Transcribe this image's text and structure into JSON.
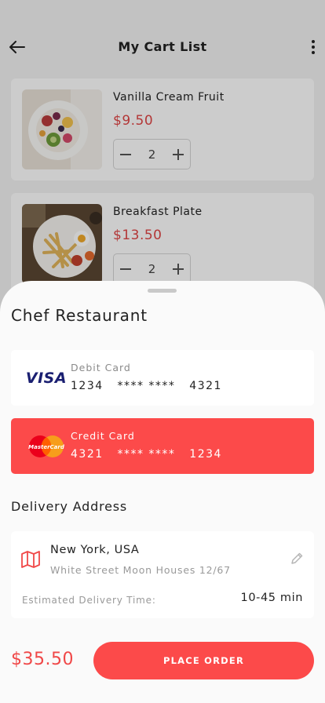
{
  "header": {
    "title": "My Cart List"
  },
  "cart_items": [
    {
      "name": "Vanilla Cream Fruit",
      "price": "$9.50",
      "quantity": "2"
    },
    {
      "name": "Breakfast Plate",
      "price": "$13.50",
      "quantity": "2"
    }
  ],
  "sheet": {
    "restaurant": "Chef Restaurant",
    "payment_methods": [
      {
        "type": "Debit Card",
        "number": "1234   **** ****   4321",
        "brand_text": "VISA",
        "selected": false
      },
      {
        "type": "Credit Card",
        "number": "4321   **** ****   1234",
        "brand_text": "MasterCard",
        "selected": true
      }
    ],
    "delivery": {
      "section_title": "Delivery Address",
      "city": "New York, USA",
      "street": "White Street Moon Houses 12/67",
      "eta_label": "Estimated Delivery Time:",
      "eta_value": "10-45 min"
    },
    "total": "$35.50",
    "order_button": "PLACE ORDER"
  },
  "colors": {
    "accent": "#fc4a4a",
    "price": "#e04545",
    "visa": "#1a1f71",
    "mastercard_red": "#eb001b",
    "mastercard_orange": "#f79e1b"
  },
  "icons": [
    "arrow-left-icon",
    "more-vertical-icon",
    "minus-icon",
    "plus-icon",
    "map-icon",
    "pencil-icon",
    "visa-logo",
    "mastercard-logo"
  ]
}
